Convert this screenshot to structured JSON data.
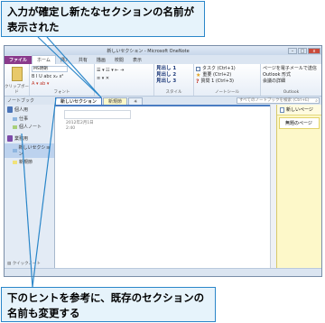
{
  "callouts": {
    "top": "入力が確定し新たなセクションの名前が表示された",
    "bottom": "下のヒントを参考に、既存のセクションの名前も変更する"
  },
  "window": {
    "title": "新しいセクション - Microsoft OneNote",
    "min": "–",
    "max": "□",
    "close": "x"
  },
  "ribbon_tabs": [
    "ファイル",
    "ホーム",
    "挿入",
    "共有",
    "描画",
    "校閲",
    "表示"
  ],
  "ribbon": {
    "clipboard": "クリップボード",
    "font_sample": "MS明朝",
    "font": "フォント",
    "styles": [
      "見出し 1",
      "見出し 2",
      "見出し 3"
    ],
    "styles_label": "スタイル",
    "tags": [
      {
        "label": "タスク (Ctrl+1)",
        "icon": "checkbox-icon"
      },
      {
        "label": "重要 (Ctrl+2)",
        "icon": "star-icon"
      },
      {
        "label": "質問 1 (Ctrl+3)",
        "icon": "question-icon"
      }
    ],
    "tags_label": "ノートシール",
    "outlook_items": [
      "ページを電子メールで送信",
      "Outlook 形式",
      "会議の詳細"
    ],
    "outlook_label": "Outlook"
  },
  "navbar": {
    "label": "ノートブック",
    "sections": [
      "新しいセクション",
      "新規節"
    ],
    "search_placeholder": "すべてのノートブックを検索 (Ctrl+E)"
  },
  "left_panel": {
    "notebooks": [
      {
        "name": "個人用",
        "sections": [
          "仕事",
          "個人ノート"
        ]
      },
      {
        "name": "業務用",
        "sections": [
          "新しいセクション",
          "新規節"
        ]
      }
    ],
    "footer": "クイックノート"
  },
  "page": {
    "date": "2012年2月1日",
    "time": "2:40"
  },
  "right_panel": {
    "new_page": "新しいページ",
    "page_title": "無題のページ"
  }
}
